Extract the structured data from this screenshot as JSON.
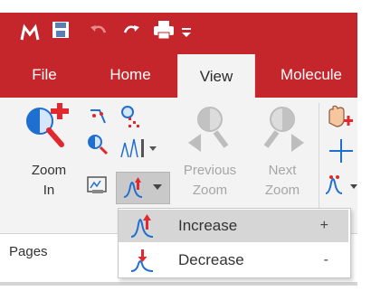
{
  "tabs": [
    {
      "label": "File"
    },
    {
      "label": "Home"
    },
    {
      "label": "View"
    },
    {
      "label": "Molecule"
    }
  ],
  "ribbon": {
    "zoom_in": {
      "line1": "Zoom",
      "line2": "In"
    },
    "previous_zoom": {
      "line1": "Previous",
      "line2": "Zoom"
    },
    "next_zoom": {
      "line1": "Next",
      "line2": "Zoom"
    }
  },
  "pages_label": "Pages",
  "menu": {
    "items": [
      {
        "label": "Increase",
        "shortcut": "+",
        "icon": "peak-increase-icon"
      },
      {
        "label": "Decrease",
        "shortcut": "-",
        "icon": "peak-decrease-icon"
      }
    ]
  },
  "colors": {
    "brand": "#c4262c",
    "ribbon_bg": "#f3f3f3",
    "menu_highlight": "#d6d6d6",
    "icon_blue": "#1f6fd1",
    "icon_red": "#e0282e"
  }
}
